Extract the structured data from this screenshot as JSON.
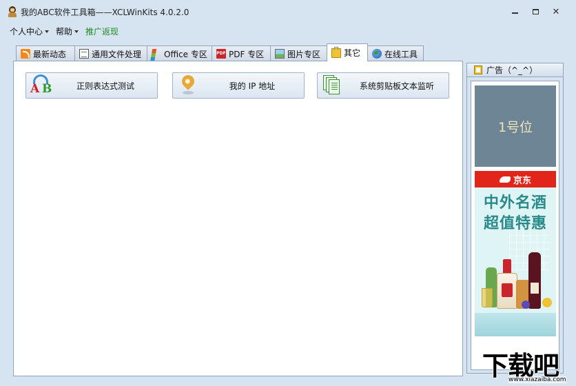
{
  "window": {
    "title": "我的ABC软件工具箱——XCLWinKits  4.0.2.0",
    "icon": "person-avatar-icon",
    "controls": {
      "minimize": "minimize-icon",
      "maximize": "maximize-icon",
      "close": "✕"
    }
  },
  "menu": {
    "items": [
      {
        "label": "个人中心",
        "dropdown": true
      },
      {
        "label": "帮助",
        "dropdown": true
      },
      {
        "label": "推广返现",
        "dropdown": false,
        "color": "#1f8a1f"
      }
    ]
  },
  "tabs": [
    {
      "label": "最新动态",
      "icon": "rss-icon"
    },
    {
      "label": "通用文件处理",
      "icon": "file-icon"
    },
    {
      "label": "Office 专区",
      "icon": "office-logo-icon"
    },
    {
      "label": "PDF 专区",
      "icon": "pdf-icon",
      "icon_text": "PDF"
    },
    {
      "label": "图片专区",
      "icon": "picture-icon"
    },
    {
      "label": "其它",
      "icon": "clipboard-icon",
      "active": true
    },
    {
      "label": "在线工具",
      "icon": "globe-icon"
    }
  ],
  "tools": [
    {
      "label": "正则表达式测试",
      "icon": "abc-regex-icon",
      "icon_letters": [
        "A",
        "B"
      ]
    },
    {
      "label": "我的 IP 地址",
      "icon": "location-pin-icon"
    },
    {
      "label": "系统剪贴板文本监听",
      "icon": "clipboard-pages-icon"
    }
  ],
  "ad_panel": {
    "title": "广告（^_^）",
    "slot1": "1号位",
    "jd_ad": {
      "brand": "京东",
      "line1": "中外名酒",
      "line2": "超值特惠",
      "brand_color": "#e1251b",
      "text_color": "#2a8a8a"
    }
  },
  "watermark": {
    "main": "下载吧",
    "url": "www.xiazaiba.com"
  }
}
